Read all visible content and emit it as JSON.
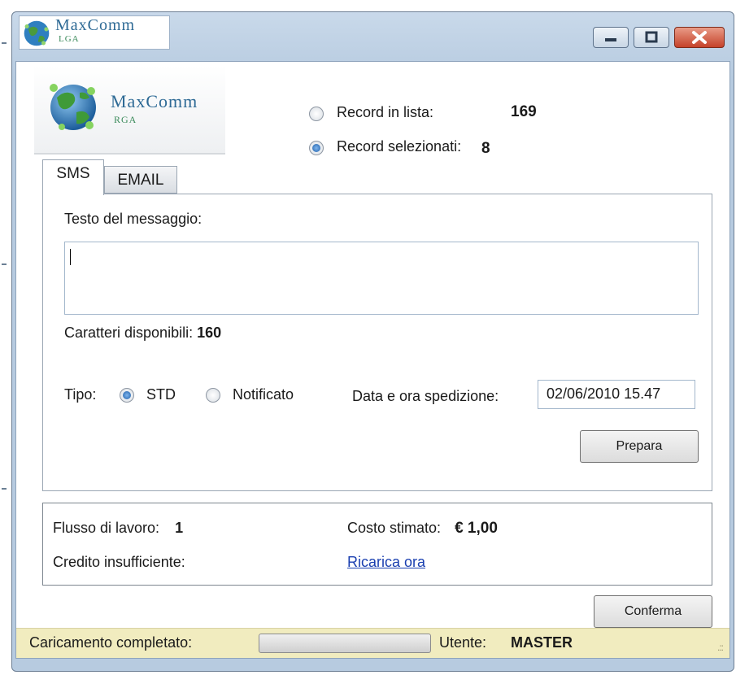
{
  "window": {
    "logo_brand": "MaxComm",
    "logo_sub": "LGA",
    "minimize_icon": "minimize-icon",
    "maximize_icon": "maximize-icon",
    "close_icon": "close-icon"
  },
  "header": {
    "brand": "MaxComm",
    "sub": "RGA"
  },
  "records": {
    "in_list_label": "Record in lista:",
    "in_list_value": "169",
    "in_list_checked": false,
    "selected_label": "Record selezionati:",
    "selected_value": "8",
    "selected_checked": true
  },
  "tabs": [
    {
      "label": "SMS",
      "active": true
    },
    {
      "label": "EMAIL",
      "active": false
    }
  ],
  "sms": {
    "message_label": "Testo del messaggio:",
    "message_value": "",
    "chars_label": "Caratteri disponibili:",
    "chars_value": "160",
    "tipo_label": "Tipo:",
    "tipo_std_label": "STD",
    "tipo_std_checked": true,
    "tipo_notificato_label": "Notificato",
    "tipo_notificato_checked": false,
    "date_label": "Data e ora spedizione:",
    "date_value": "02/06/2010 15.47",
    "prepare_button": "Prepara"
  },
  "info": {
    "workflow_label": "Flusso di lavoro:",
    "workflow_value": "1",
    "cost_label": "Costo stimato:",
    "cost_value": "€ 1,00",
    "credit_label": "Credito insufficiente:",
    "recharge_link": "Ricarica ora"
  },
  "confirm_button": "Conferma",
  "status": {
    "loading_label": "Caricamento completato:",
    "progress": 0,
    "user_label": "Utente:",
    "user_value": "MASTER"
  },
  "colors": {
    "frame": "#b7cbe0",
    "status_bg": "#f1ecbf",
    "link": "#1a3fb0",
    "close_button": "#c5422a"
  }
}
